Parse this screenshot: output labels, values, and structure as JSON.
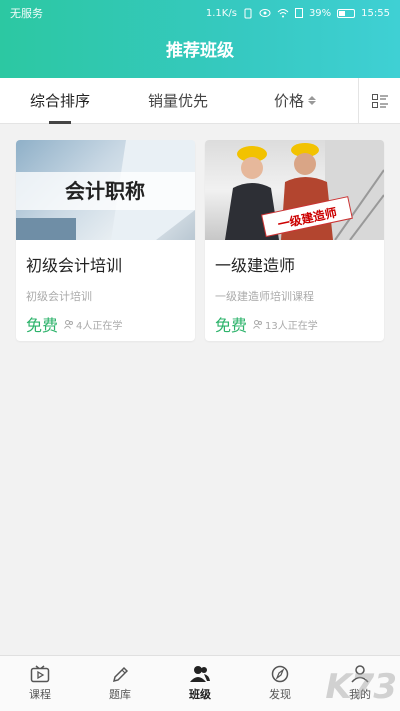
{
  "status_bar": {
    "carrier": "无服务",
    "speed": "1.1K/s",
    "battery": "39%",
    "time": "15:55"
  },
  "header": {
    "title": "推荐班级"
  },
  "sort": {
    "tabs": [
      "综合排序",
      "销量优先",
      "价格"
    ]
  },
  "courses": [
    {
      "banner_text": "会计职称",
      "title": "初级会计培训",
      "subtitle": "初级会计培训",
      "price": "免费",
      "learners": "4人正在学"
    },
    {
      "banner_text": "一级建造师",
      "title": "一级建造师",
      "subtitle": "一级建造师培训课程",
      "price": "免费",
      "learners": "13人正在学"
    }
  ],
  "tabbar": {
    "items": [
      "课程",
      "题库",
      "班级",
      "发现",
      "我的"
    ],
    "active": "班级"
  },
  "watermark": "K73",
  "colors": {
    "header_start": "#2cc8a2",
    "header_end": "#3fd0d4",
    "price": "#2db36b"
  }
}
